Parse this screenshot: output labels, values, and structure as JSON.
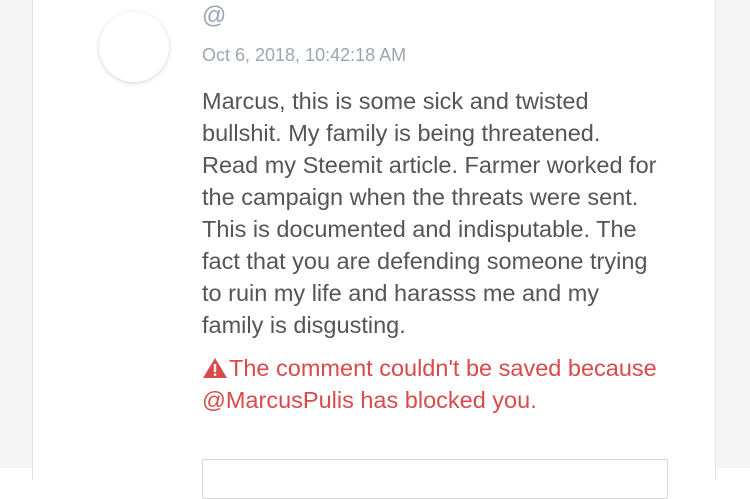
{
  "comment": {
    "username": "@",
    "timestamp": "Oct 6, 2018, 10:42:18 AM",
    "body_lines": [
      "Marcus, this is some sick and twisted",
      "bullshit. My family is being threatened.",
      "Read my Steemit article. Farmer worked for",
      "the campaign when the threats were sent.",
      "This is documented and indisputable. The",
      "fact that you are defending someone trying",
      "to ruin my life and harasss me and my",
      "family is disgusting."
    ]
  },
  "error": {
    "icon": "warning-triangle-icon",
    "color": "#d94a4a",
    "lines": [
      "The comment couldn't be saved because",
      "@MarcusPulis has blocked you."
    ]
  },
  "colors": {
    "meta_text": "#9aa6b2",
    "body_text": "#555555"
  }
}
